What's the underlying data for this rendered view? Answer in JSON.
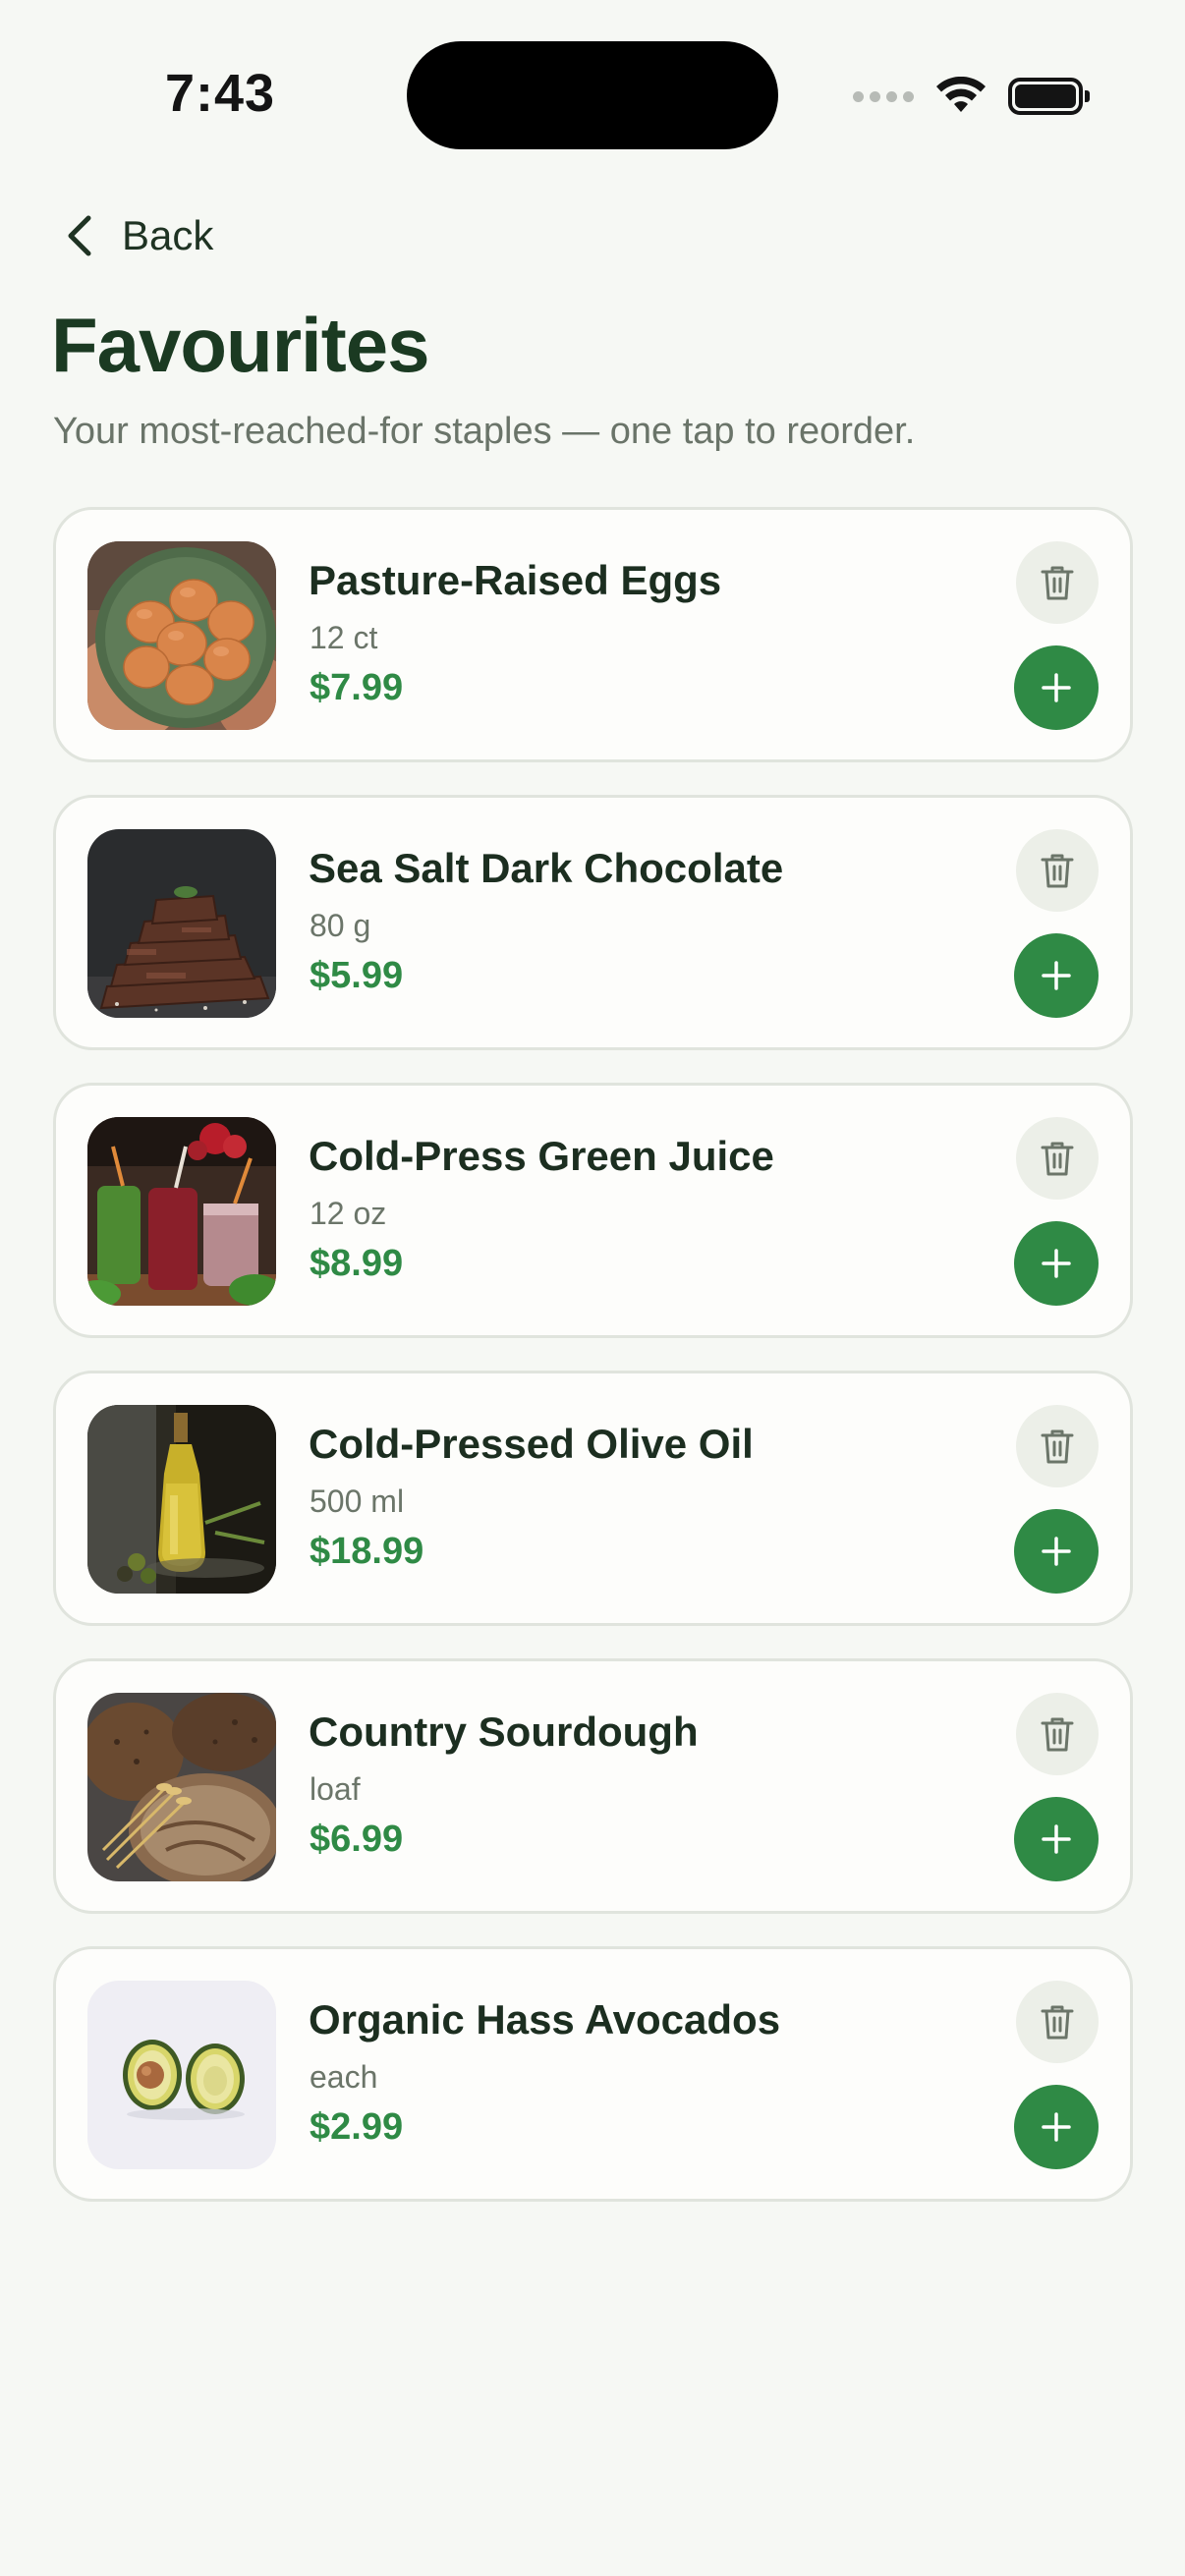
{
  "status_bar": {
    "time": "7:43"
  },
  "header": {
    "back_label": "Back",
    "title": "Favourites",
    "subtitle": "Your most-reached-for staples — one tap to reorder."
  },
  "colors": {
    "accent_green": "#2f8a45",
    "title_green": "#1b3a22",
    "background": "#f6f8f4",
    "card_border": "#e0e4dd",
    "delete_bg": "#ecefe8"
  },
  "favourites": [
    {
      "name": "Pasture-Raised Eggs",
      "size": "12 ct",
      "price": "$7.99",
      "image": "eggs-in-bowl-photo"
    },
    {
      "name": "Sea Salt Dark Chocolate",
      "size": "80 g",
      "price": "$5.99",
      "image": "chocolate-stack-photo"
    },
    {
      "name": "Cold-Press Green Juice",
      "size": "12 oz",
      "price": "$8.99",
      "image": "juice-jars-photo"
    },
    {
      "name": "Cold-Pressed Olive Oil",
      "size": "500 ml",
      "price": "$18.99",
      "image": "olive-oil-bottle-photo"
    },
    {
      "name": "Country Sourdough",
      "size": "loaf",
      "price": "$6.99",
      "image": "sourdough-bread-photo"
    },
    {
      "name": "Organic Hass Avocados",
      "size": "each",
      "price": "$2.99",
      "image": "avocado-halves-photo"
    }
  ],
  "icons": {
    "back": "chevron-left-icon",
    "delete": "trash-icon",
    "add": "plus-icon"
  }
}
